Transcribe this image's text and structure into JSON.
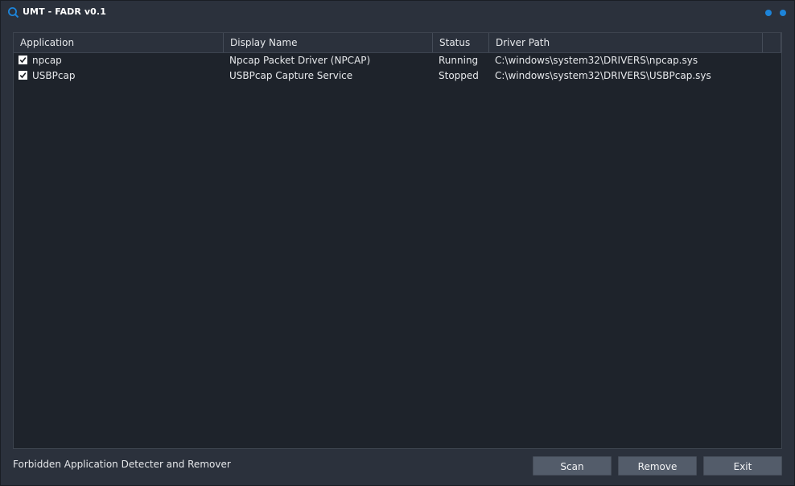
{
  "window": {
    "title": "UMT - FADR v0.1",
    "accent_color": "#1d84d9",
    "icon": "magnifier-icon"
  },
  "table": {
    "columns": [
      "Application",
      "Display Name",
      "Status",
      "Driver Path",
      ""
    ],
    "rows": [
      {
        "checked": true,
        "application": "npcap",
        "display_name": "Npcap Packet Driver (NPCAP)",
        "status": "Running",
        "driver_path": "C:\\windows\\system32\\DRIVERS\\npcap.sys"
      },
      {
        "checked": true,
        "application": "USBPcap",
        "display_name": "USBPcap Capture Service",
        "status": "Stopped",
        "driver_path": "C:\\windows\\system32\\DRIVERS\\USBPcap.sys"
      }
    ]
  },
  "footer": {
    "description": "Forbidden Application Detecter and Remover",
    "scan_label": "Scan",
    "remove_label": "Remove",
    "exit_label": "Exit"
  }
}
